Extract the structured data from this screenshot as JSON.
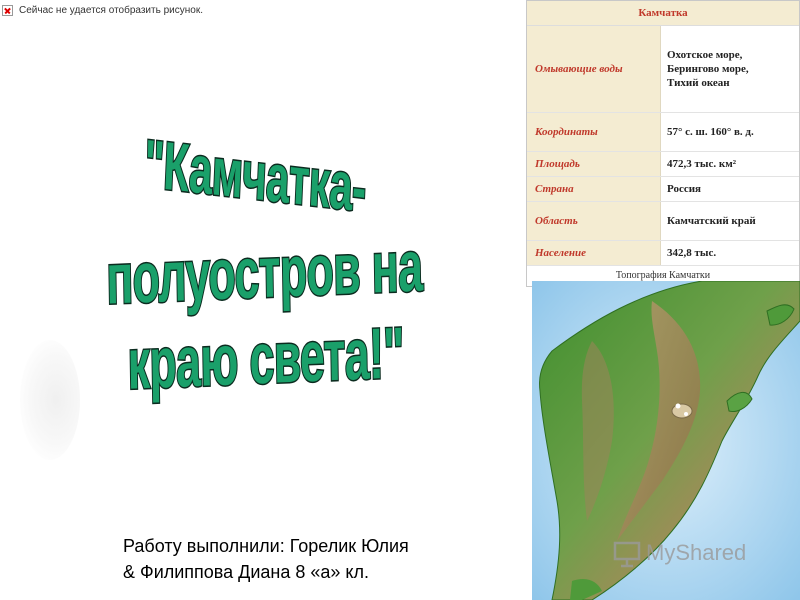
{
  "broken_image": {
    "text": "Сейчас не удается отобразить рисунок.",
    "icon": "broken-image-icon"
  },
  "title": {
    "line1": "\"Камчатка-",
    "line2": "полуостров на краю света!\""
  },
  "authors": {
    "line1": "Работу выполнили: Горелик Юлия",
    "line2": "& Филиппова Диана 8 «а» кл."
  },
  "infobox": {
    "header": "Камчатка",
    "rows": [
      {
        "key": "Омывающие воды",
        "value_lines": [
          "Охотское море,",
          "Берингово море,",
          "Тихий океан"
        ]
      },
      {
        "key": "Координаты",
        "value": "57° с. ш. 160° в. д."
      },
      {
        "key": "Площадь",
        "value": "472,3 тыс. км²"
      },
      {
        "key": "Страна",
        "value": "Россия"
      },
      {
        "key": "Область",
        "value": "Камчатский край"
      },
      {
        "key": "Население",
        "value": "342,8 тыс."
      }
    ],
    "caption": "Топография Камчатки"
  },
  "watermark": {
    "text": "MyShared",
    "icon": "presentation-board-icon"
  },
  "colors": {
    "title_fill": "#1aa06a",
    "title_outline": "#0b2b1f",
    "infobox_key_bg": "#f4ecd2",
    "infobox_key_text": "#c0392b"
  }
}
